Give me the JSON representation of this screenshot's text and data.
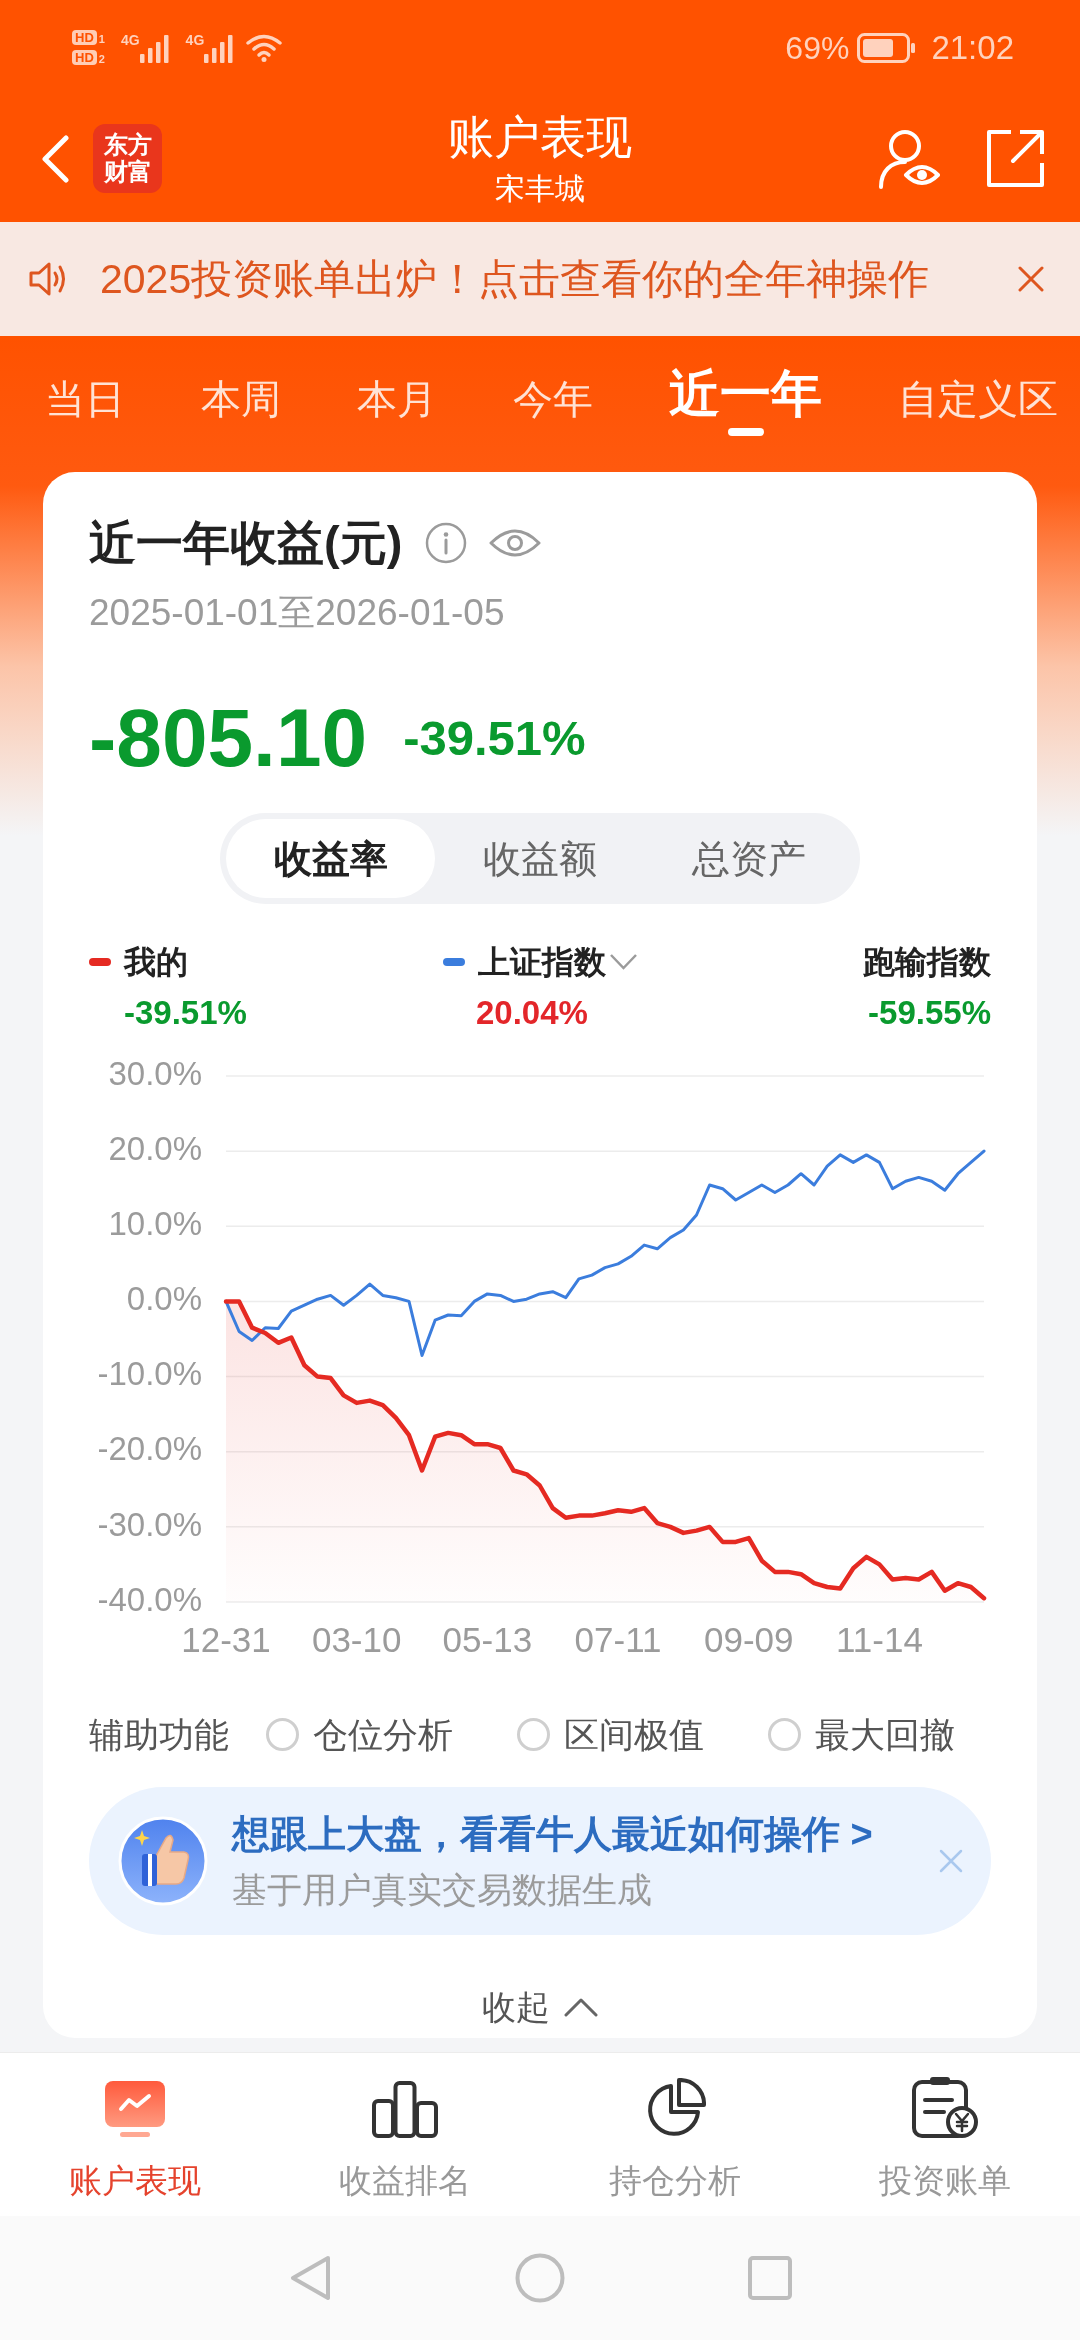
{
  "status_bar": {
    "sims": [
      {
        "badge": "HD",
        "slot": "1",
        "network": "4G"
      },
      {
        "badge": "HD",
        "slot": "2",
        "network": "4G"
      }
    ],
    "battery": "69%",
    "time": "21:02"
  },
  "header": {
    "logo": "东方财富",
    "title": "账户表现",
    "subtitle": "宋丰城"
  },
  "notice": {
    "text": "2025投资账单出炉！点击查看你的全年神操作"
  },
  "period_tabs": [
    {
      "label": "当日",
      "selected": false
    },
    {
      "label": "本周",
      "selected": false
    },
    {
      "label": "本月",
      "selected": false
    },
    {
      "label": "今年",
      "selected": false
    },
    {
      "label": "近一年",
      "selected": true
    },
    {
      "label": "自定义区",
      "selected": false
    }
  ],
  "returns_card": {
    "title": "近一年收益(元)",
    "date_range": "2025-01-01至2026-01-05",
    "amount": "-805.10",
    "rate": "-39.51%",
    "gain": false,
    "metric_tabs": [
      {
        "label": "收益率",
        "selected": true
      },
      {
        "label": "收益额",
        "selected": false
      },
      {
        "label": "总资产",
        "selected": false
      }
    ],
    "legend": [
      {
        "kind": "series",
        "value": "-39.51%",
        "gain": false
      },
      {
        "kind": "series_select",
        "value": "20.04%",
        "gain": true
      },
      {
        "kind": "plain",
        "label": "跑输指数",
        "value": "-59.55%",
        "gain": false
      }
    ],
    "chart_data": {
      "type": "line",
      "grid": true,
      "categories": [
        "12-31",
        null,
        null,
        null,
        null,
        null,
        null,
        null,
        null,
        null,
        "03-10",
        null,
        null,
        null,
        null,
        null,
        null,
        null,
        null,
        null,
        "05-13",
        null,
        null,
        null,
        null,
        null,
        null,
        null,
        null,
        null,
        "07-11",
        null,
        null,
        null,
        null,
        null,
        null,
        null,
        null,
        null,
        "09-09",
        null,
        null,
        null,
        null,
        null,
        null,
        null,
        null,
        null,
        "11-14",
        null,
        null,
        null,
        null,
        null,
        null,
        null,
        null
      ],
      "ylim": [
        -40,
        30
      ],
      "yticks": [
        {
          "value": 30,
          "label": "30.0%"
        },
        {
          "value": 20,
          "label": "20.0%"
        },
        {
          "value": 10,
          "label": "10.0%"
        },
        {
          "value": 0,
          "label": "0.0%"
        },
        {
          "value": -10,
          "label": "-10.0%"
        },
        {
          "value": -20,
          "label": "-20.0%"
        },
        {
          "value": -30,
          "label": "-30.0%"
        },
        {
          "value": -40,
          "label": "-40.0%"
        }
      ],
      "series": [
        {
          "name": "我的",
          "color": "#e52a22",
          "values": [
            0,
            0,
            -3.5,
            -4.2,
            -5.5,
            -4.8,
            -8.5,
            -10.0,
            -10.2,
            -12.5,
            -13.5,
            -13.2,
            -13.8,
            -15.5,
            -17.8,
            -22.5,
            -18.0,
            -17.5,
            -17.8,
            -19.0,
            -19.0,
            -19.5,
            -22.5,
            -23.0,
            -24.5,
            -27.5,
            -28.8,
            -28.5,
            -28.5,
            -28.2,
            -27.8,
            -28.0,
            -27.5,
            -29.5,
            -30.0,
            -30.8,
            -30.5,
            -30.0,
            -32.0,
            -32.0,
            -31.5,
            -34.5,
            -36.0,
            -36.0,
            -36.3,
            -37.5,
            -38.0,
            -38.2,
            -35.5,
            -34.0,
            -35.0,
            -37.0,
            -36.8,
            -37.0,
            -36.0,
            -38.5,
            -37.5,
            -38.0,
            -39.5
          ]
        },
        {
          "name": "上证指数",
          "color": "#3b7ddd",
          "values": [
            0,
            -4.0,
            -5.2,
            -3.5,
            -3.6,
            -1.3,
            -0.5,
            0.3,
            0.8,
            -0.5,
            0.8,
            2.3,
            0.8,
            0.5,
            0.0,
            -7.2,
            -2.5,
            -1.8,
            -1.9,
            0.0,
            1.0,
            0.8,
            0.0,
            0.3,
            1.0,
            1.3,
            0.5,
            3.0,
            3.5,
            4.5,
            5.0,
            6.0,
            7.5,
            7.0,
            8.5,
            9.5,
            11.5,
            15.5,
            15.0,
            13.5,
            14.5,
            15.5,
            14.5,
            15.5,
            17.0,
            15.5,
            18.0,
            19.5,
            18.5,
            19.5,
            18.5,
            15.0,
            16.0,
            16.5,
            16.0,
            14.8,
            17.0,
            18.5,
            20.0
          ]
        }
      ]
    },
    "tools": {
      "label": "辅助功能",
      "options": [
        {
          "label": "仓位分析",
          "checked": false
        },
        {
          "label": "区间极值",
          "checked": false
        },
        {
          "label": "最大回撤",
          "checked": false
        }
      ]
    },
    "promo": {
      "title": "想跟上大盘，看看牛人最近如何操作 >",
      "subtitle": "基于用户真实交易数据生成"
    },
    "collapse_label": "收起"
  },
  "bottom_nav": [
    {
      "label": "账户表现",
      "selected": true
    },
    {
      "label": "收益排名",
      "selected": false
    },
    {
      "label": "持仓分析",
      "selected": false
    },
    {
      "label": "投资账单",
      "selected": false
    }
  ]
}
